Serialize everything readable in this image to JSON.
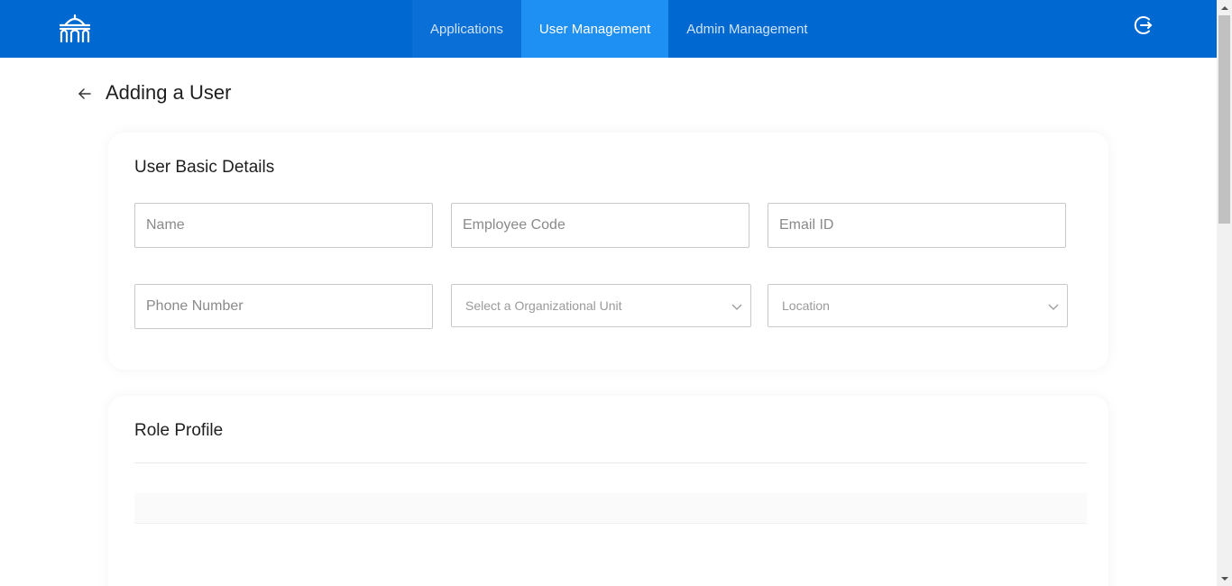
{
  "header": {
    "logo_icon": "building-arches-logo-icon",
    "nav": [
      {
        "label": "Applications"
      },
      {
        "label": "User Management"
      },
      {
        "label": "Admin Management"
      }
    ],
    "active_tab": "User Management",
    "logout_icon": "logout-icon"
  },
  "page": {
    "back_icon": "arrow-left-icon",
    "title": "Adding a User"
  },
  "basic_details": {
    "title": "User Basic Details",
    "name_placeholder": "Name",
    "employee_code_placeholder": "Employee Code",
    "email_placeholder": "Email ID",
    "phone_placeholder": "Phone Number",
    "org_unit_placeholder": "Select a Organizational Unit",
    "location_placeholder": "Location"
  },
  "role_profile": {
    "title": "Role Profile"
  },
  "colors": {
    "header_bg": "#0069d1",
    "active_tab_bg": "#1e8ff3",
    "page_bg": "#ffffff"
  }
}
